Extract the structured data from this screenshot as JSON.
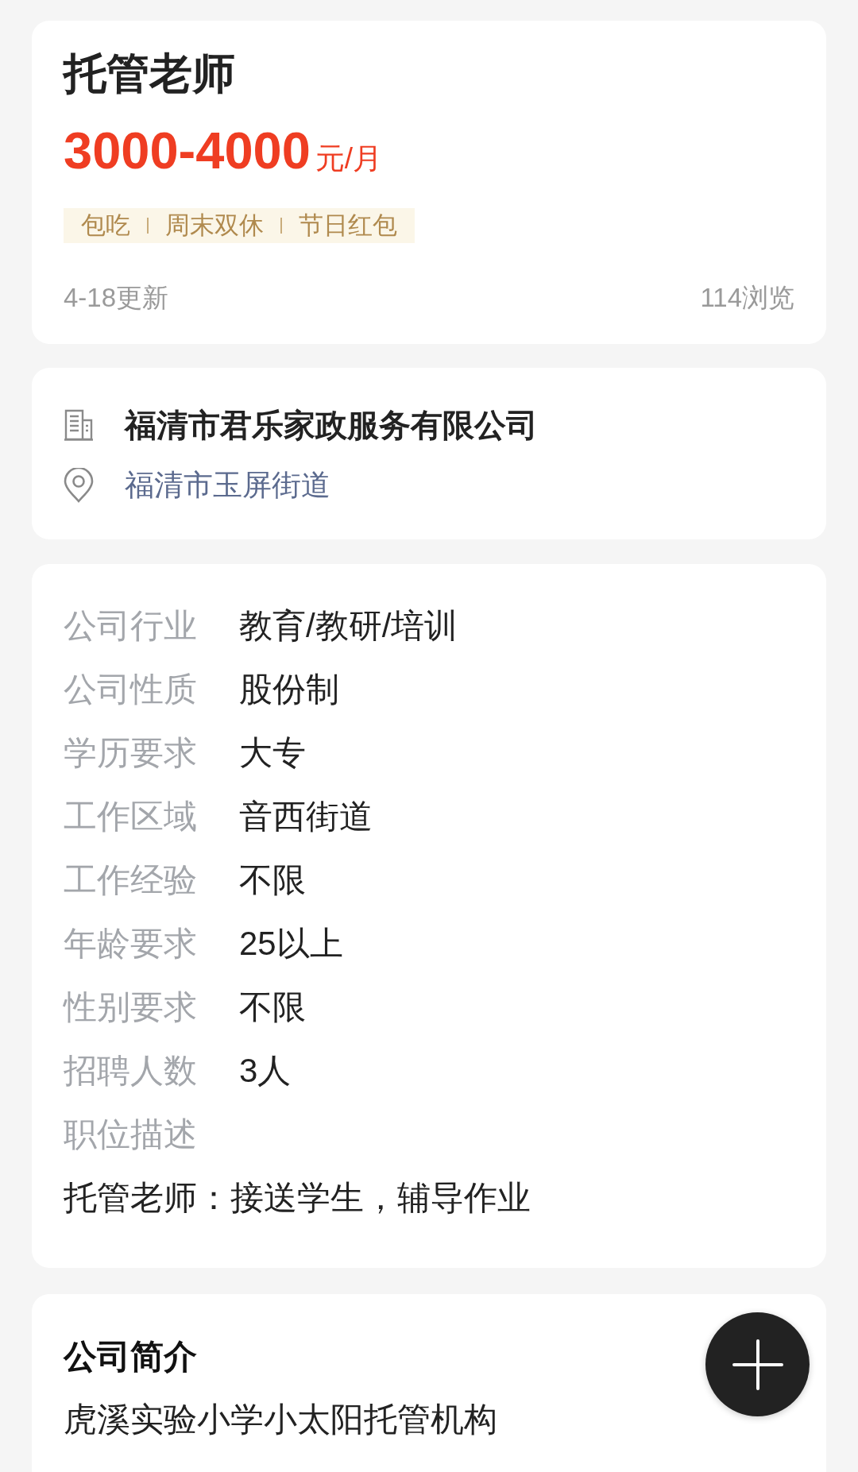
{
  "job": {
    "title": "托管老师",
    "salary": {
      "amount": "3000-4000",
      "unit": "元/月"
    },
    "tags": [
      "包吃",
      "周末双休",
      "节日红包"
    ],
    "updated": "4-18更新",
    "views": "114浏览"
  },
  "company": {
    "name": "福清市君乐家政服务有限公司",
    "location": "福清市玉屏街道"
  },
  "details": {
    "rows": [
      {
        "label": "公司行业",
        "value": "教育/教研/培训"
      },
      {
        "label": "公司性质",
        "value": "股份制"
      },
      {
        "label": "学历要求",
        "value": "大专"
      },
      {
        "label": "工作区域",
        "value": "音西街道"
      },
      {
        "label": "工作经验",
        "value": "不限"
      },
      {
        "label": "年龄要求",
        "value": "25以上"
      },
      {
        "label": "性别要求",
        "value": "不限"
      },
      {
        "label": "招聘人数",
        "value": "3人"
      }
    ],
    "description": {
      "label": "职位描述",
      "text": "托管老师：接送学生，辅导作业"
    }
  },
  "company_intro": {
    "title": "公司简介",
    "text": "虎溪实验小学小太阳托管机构"
  }
}
